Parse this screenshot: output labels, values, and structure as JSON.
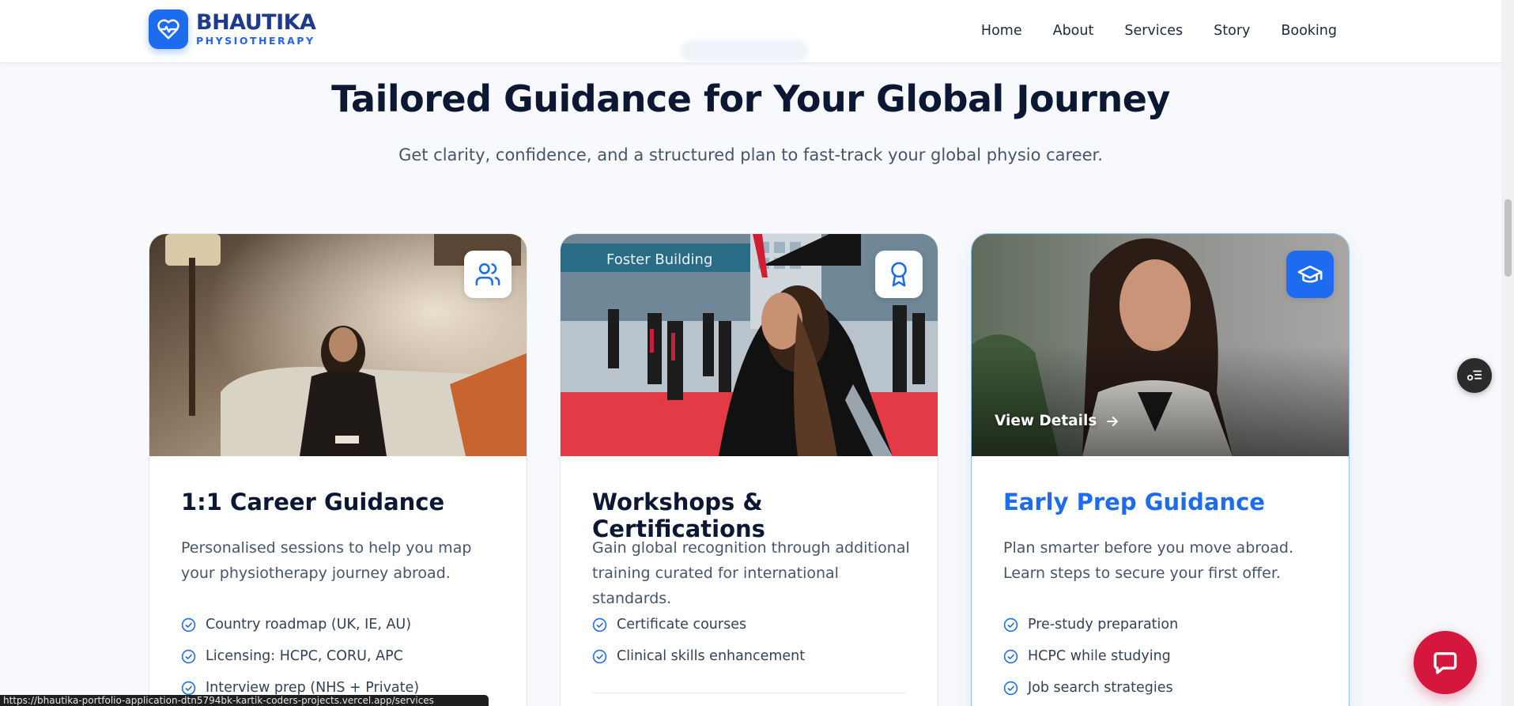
{
  "brand": {
    "name": "BHAUTIKA",
    "tagline": "PHYSIOTHERAPY"
  },
  "nav": [
    "Home",
    "About",
    "Services",
    "Story",
    "Booking"
  ],
  "section": {
    "title": "Tailored Guidance for Your Global Journey",
    "subtitle": "Get clarity, confidence, and a structured plan to fast-track your global physio career."
  },
  "cards": [
    {
      "title": "1:1 Career Guidance",
      "icon": "users-icon",
      "description": "Personalised sessions to help you map your physiotherapy journey abroad.",
      "features": [
        "Country roadmap (UK, IE, AU)",
        "Licensing: HCPC, CORU, APC",
        "Interview prep (NHS + Private)"
      ]
    },
    {
      "title": "Workshops & Certifications",
      "icon": "award-icon",
      "description": "Gain global recognition through additional training curated for international standards.",
      "features": [
        "Certificate courses",
        "Clinical skills enhancement"
      ],
      "photo_sign": "Foster Building"
    },
    {
      "title": "Early Prep Guidance",
      "icon": "graduation-cap-icon",
      "description": "Plan smarter before you move abroad. Learn steps to secure your first offer.",
      "features": [
        "Pre-study preparation",
        "HCPC while studying",
        "Job search strategies"
      ],
      "cta": "View Details"
    }
  ],
  "status_bar": {
    "url": "https://bhautika-portfolio-application-dtn5794bk-kartik-coders-projects.vercel.app/services"
  },
  "colors": {
    "accent": "#1d6cf0",
    "brand_dark": "#1e3a8a",
    "chat": "#d5163d"
  }
}
